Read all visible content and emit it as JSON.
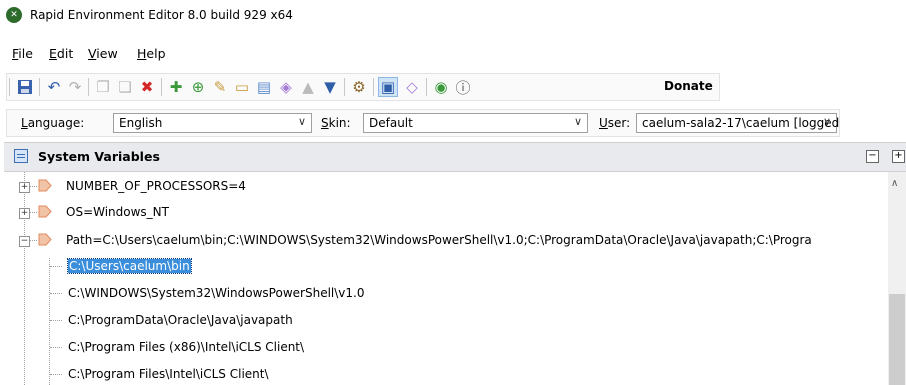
{
  "window": {
    "title": "Rapid Environment Editor 8.0 build 929 x64"
  },
  "menu": [
    {
      "label": "File",
      "key": "F",
      "rest": "ile"
    },
    {
      "label": "Edit",
      "key": "E",
      "rest": "dit"
    },
    {
      "label": "View",
      "key": "V",
      "rest": "iew"
    },
    {
      "label": "Help",
      "key": "H",
      "rest": "elp"
    }
  ],
  "toolbar": {
    "donate": "Donate"
  },
  "options": {
    "language_key": "L",
    "language_rest": "anguage:",
    "language_value": "English",
    "skin_key": "S",
    "skin_rest": "kin:",
    "skin_value": "Default",
    "user_key": "U",
    "user_rest": "ser:",
    "user_value": "caelum-sala2-17\\caelum [logged"
  },
  "panel": {
    "title": "System Variables"
  },
  "tree": {
    "items": [
      {
        "label": "NUMBER_OF_PROCESSORS=4",
        "expander": "+"
      },
      {
        "label": "OS=Windows_NT",
        "expander": "+"
      },
      {
        "label": "Path=C:\\Users\\caelum\\bin;C:\\WINDOWS\\System32\\WindowsPowerShell\\v1.0;C:\\ProgramData\\Oracle\\Java\\javapath;C:\\Progra",
        "expander": "−"
      }
    ],
    "children": [
      "C:\\Users\\caelum\\bin",
      "C:\\WINDOWS\\System32\\WindowsPowerShell\\v1.0",
      "C:\\ProgramData\\Oracle\\Java\\javapath",
      "C:\\Program Files (x86)\\Intel\\iCLS Client\\",
      "C:\\Program Files\\Intel\\iCLS Client\\"
    ]
  },
  "colors": {
    "accent": "#3b8edb",
    "tag": "#e8a27c"
  }
}
